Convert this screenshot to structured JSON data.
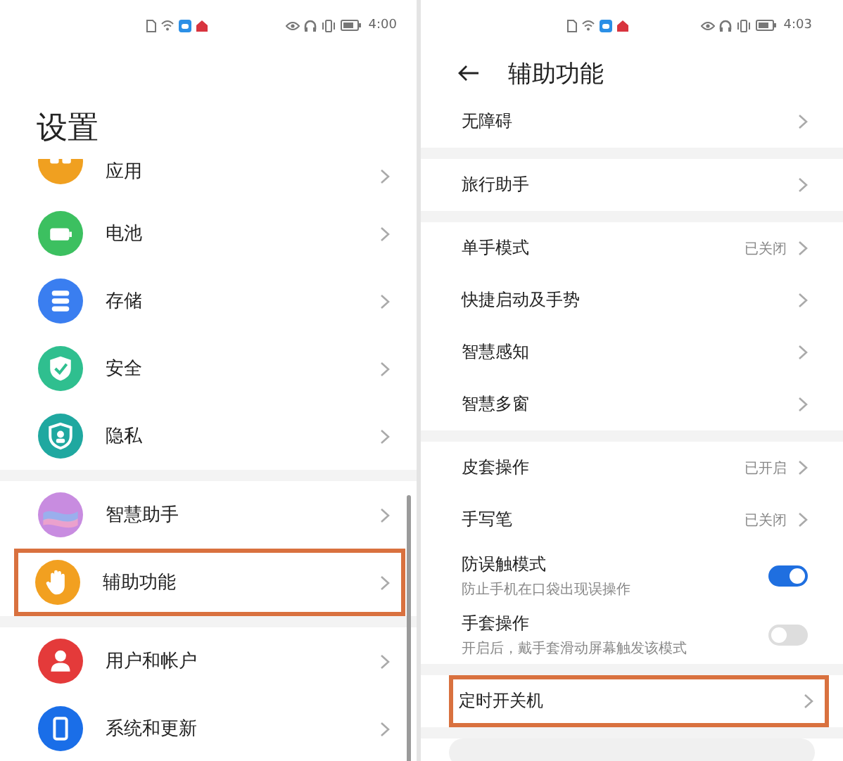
{
  "left_screen": {
    "status_bar": {
      "time": "4:00"
    },
    "title": "设置",
    "groups": [
      [
        {
          "label": "应用",
          "kind": "apps",
          "color": "#f0a020",
          "highlighted": false
        },
        {
          "label": "电池",
          "kind": "battery",
          "color": "#3cc060",
          "highlighted": false
        },
        {
          "label": "存储",
          "kind": "storage",
          "color": "#3a7ef0",
          "highlighted": false
        },
        {
          "label": "安全",
          "kind": "security",
          "color": "#2fbf8f",
          "highlighted": false
        },
        {
          "label": "隐私",
          "kind": "privacy",
          "color": "#1fa8a0",
          "highlighted": false
        }
      ],
      [
        {
          "label": "智慧助手",
          "kind": "assistant",
          "color": "#c88ce0",
          "highlighted": false
        },
        {
          "label": "辅助功能",
          "kind": "accessibility",
          "color": "#f2a020",
          "highlighted": true
        }
      ],
      [
        {
          "label": "用户和帐户",
          "kind": "user",
          "color": "#e43a3a",
          "highlighted": false
        },
        {
          "label": "系统和更新",
          "kind": "system",
          "color": "#1a6ee8",
          "highlighted": false
        }
      ]
    ]
  },
  "right_screen": {
    "status_bar": {
      "time": "4:03"
    },
    "title": "辅助功能",
    "groups": [
      [
        {
          "label": "无障碍",
          "kind": "link",
          "highlighted": false
        }
      ],
      [
        {
          "label": "旅行助手",
          "kind": "link",
          "highlighted": false
        }
      ],
      [
        {
          "label": "单手模式",
          "kind": "link",
          "value": "已关闭",
          "highlighted": false
        },
        {
          "label": "快捷启动及手势",
          "kind": "link",
          "highlighted": false
        },
        {
          "label": "智慧感知",
          "kind": "link",
          "highlighted": false
        },
        {
          "label": "智慧多窗",
          "kind": "link",
          "highlighted": false
        }
      ],
      [
        {
          "label": "皮套操作",
          "kind": "link",
          "value": "已开启",
          "highlighted": false
        },
        {
          "label": "手写笔",
          "kind": "link",
          "value": "已关闭",
          "highlighted": false
        },
        {
          "label": "防误触模式",
          "kind": "toggle",
          "subtitle": "防止手机在口袋出现误操作",
          "on": true,
          "highlighted": false
        },
        {
          "label": "手套操作",
          "kind": "toggle",
          "subtitle": "开启后，戴手套滑动屏幕触发该模式",
          "on": false,
          "highlighted": false
        }
      ],
      [
        {
          "label": "定时开关机",
          "kind": "link",
          "highlighted": true
        }
      ]
    ]
  }
}
